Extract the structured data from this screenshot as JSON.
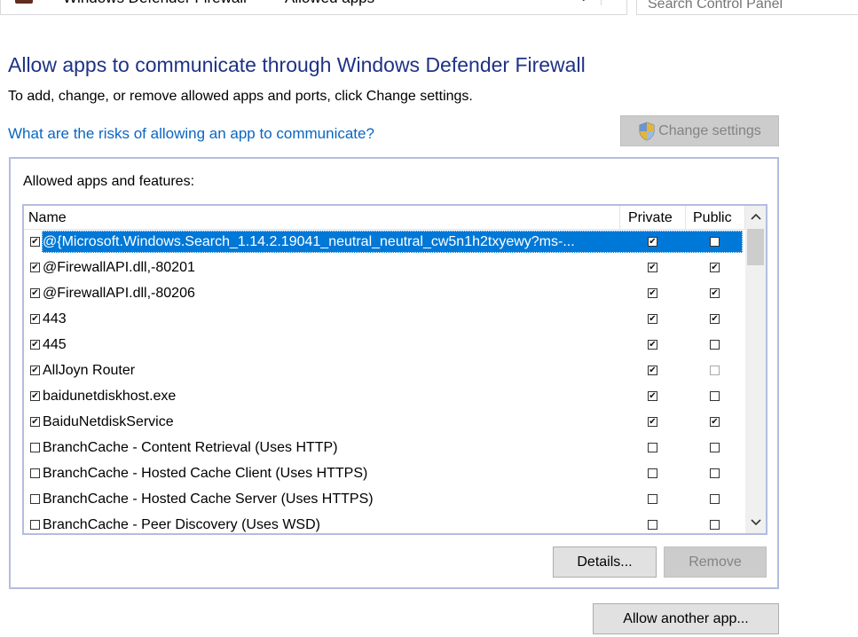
{
  "window": {
    "breadcrumb": [
      "Windows Defender Firewall",
      "Allowed apps"
    ],
    "breadcrumb_separator": "«",
    "search": {
      "placeholder": "Search Control Panel",
      "value": ""
    }
  },
  "header": {
    "title": "Allow apps to communicate through Windows Defender Firewall",
    "description": "To add, change, or remove allowed apps and ports, click Change settings.",
    "risk_link": "What are the risks of allowing an app to communicate?",
    "change_settings_label": "Change settings"
  },
  "apps": {
    "group_label": "Allowed apps and features:",
    "columns": {
      "name": "Name",
      "private": "Private",
      "public": "Public"
    },
    "rows": [
      {
        "name": "@{Microsoft.Windows.Search_1.14.2.19041_neutral_neutral_cw5n1h2txyewy?ms-...",
        "enabled": true,
        "private": true,
        "public": false,
        "selected": true
      },
      {
        "name": "@FirewallAPI.dll,-80201",
        "enabled": true,
        "private": true,
        "public": true
      },
      {
        "name": "@FirewallAPI.dll,-80206",
        "enabled": true,
        "private": true,
        "public": true
      },
      {
        "name": "443",
        "enabled": true,
        "private": true,
        "public": true
      },
      {
        "name": "445",
        "enabled": true,
        "private": true,
        "public": false
      },
      {
        "name": "AllJoyn Router",
        "enabled": true,
        "private": true,
        "public": false,
        "public_light": true
      },
      {
        "name": "baidunetdiskhost.exe",
        "enabled": true,
        "private": true,
        "public": false
      },
      {
        "name": "BaiduNetdiskService",
        "enabled": true,
        "private": true,
        "public": true
      },
      {
        "name": "BranchCache - Content Retrieval (Uses HTTP)",
        "enabled": false,
        "private": false,
        "public": false
      },
      {
        "name": "BranchCache - Hosted Cache Client (Uses HTTPS)",
        "enabled": false,
        "private": false,
        "public": false
      },
      {
        "name": "BranchCache - Hosted Cache Server (Uses HTTPS)",
        "enabled": false,
        "private": false,
        "public": false
      },
      {
        "name": "BranchCache - Peer Discovery (Uses WSD)",
        "enabled": false,
        "private": false,
        "public": false
      }
    ],
    "details_label": "Details...",
    "remove_label": "Remove"
  },
  "footer": {
    "allow_another_label": "Allow another app..."
  },
  "colors": {
    "title": "#1e3287",
    "link": "#0a66c2",
    "selection": "#0078d7",
    "border": "#b3bde0"
  }
}
